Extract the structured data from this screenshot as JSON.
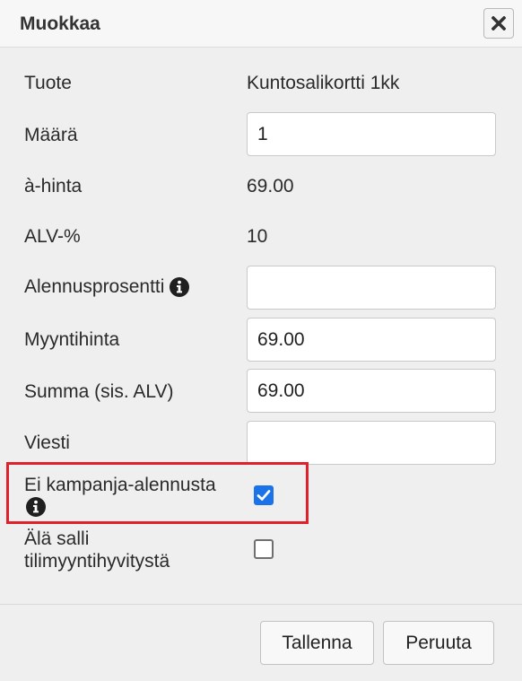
{
  "dialog": {
    "title": "Muokkaa",
    "close_icon": "close-icon"
  },
  "form": {
    "product": {
      "label": "Tuote",
      "value": "Kuntosalikortti 1kk"
    },
    "quantity": {
      "label": "Määrä",
      "value": "1"
    },
    "unit_price": {
      "label": "à-hinta",
      "value": "69.00"
    },
    "vat_percent": {
      "label": "ALV-%",
      "value": "10"
    },
    "discount_percent": {
      "label": "Alennusprosentti",
      "value": "",
      "info_icon": "info-icon"
    },
    "sale_price": {
      "label": "Myyntihinta",
      "value": "69.00"
    },
    "total": {
      "label": "Summa (sis. ALV)",
      "value": "69.00"
    },
    "message": {
      "label": "Viesti",
      "value": ""
    },
    "no_campaign_discount": {
      "label": "Ei kampanja-alennusta",
      "checked": true,
      "info_icon": "info-icon"
    },
    "no_account_refund": {
      "label_line1": "Älä salli",
      "label_line2": "tilimyyntihyvitystä",
      "checked": false
    }
  },
  "footer": {
    "save_label": "Tallenna",
    "cancel_label": "Peruuta"
  },
  "colors": {
    "accent": "#1a73e8",
    "highlight": "#e0212b"
  }
}
